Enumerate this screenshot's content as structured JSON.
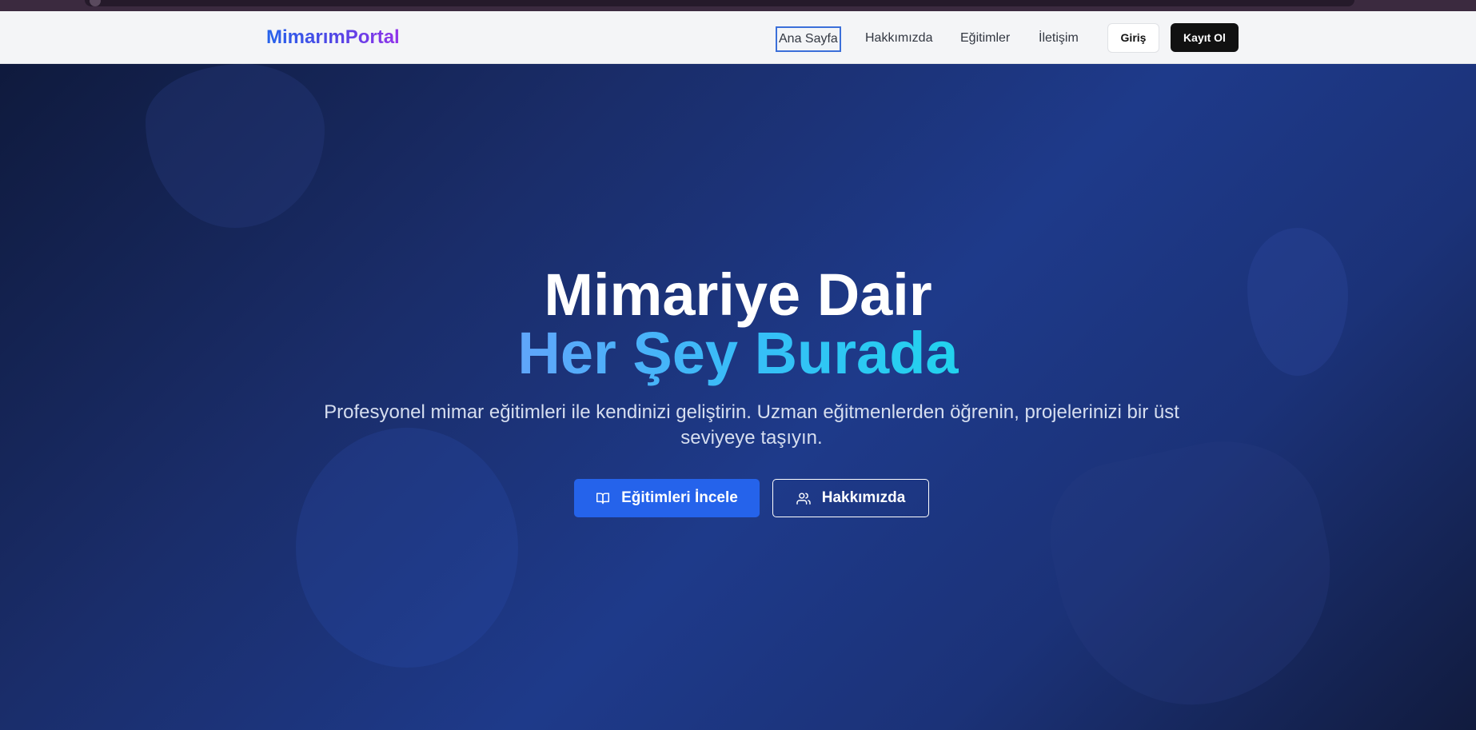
{
  "navbar": {
    "logo": "MimarımPortal",
    "links": [
      {
        "label": "Ana Sayfa",
        "active": true
      },
      {
        "label": "Hakkımızda"
      },
      {
        "label": "Eğitimler"
      },
      {
        "label": "İletişim"
      }
    ],
    "login_label": "Giriş",
    "register_label": "Kayıt Ol"
  },
  "hero": {
    "title": "Mimariye Dair",
    "subtitle": "Her Şey Burada",
    "description": "Profesyonel mimar eğitimleri ile kendinizi geliştirin. Uzman eğitmenlerden öğrenin, projelerinizi bir üst seviyeye taşıyın.",
    "primary_button": {
      "label": "Eğitimleri İncele",
      "icon": "book-open-icon"
    },
    "secondary_button": {
      "label": "Hakkımızda",
      "icon": "users-icon"
    }
  },
  "colors": {
    "primary": "#2563eb",
    "navbar_bg": "#f4f5f7",
    "hero_bg": "#1e3a8a"
  }
}
